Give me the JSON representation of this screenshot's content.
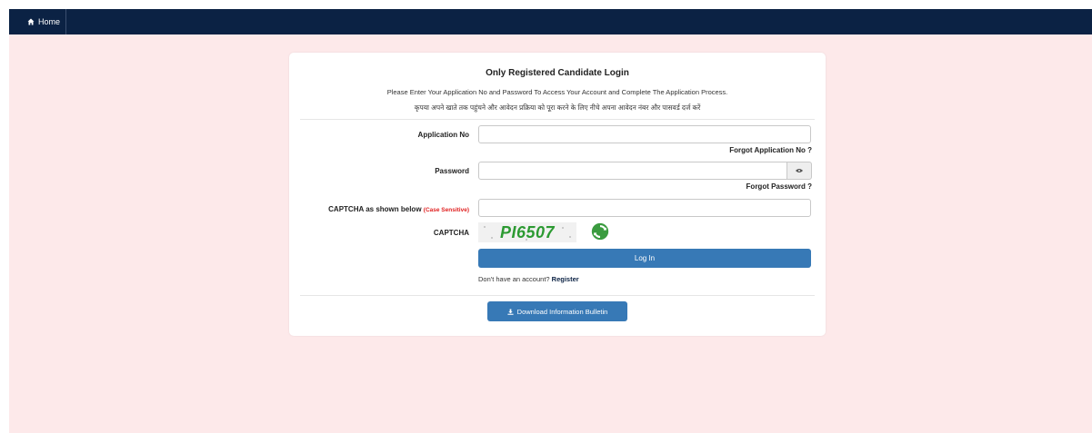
{
  "nav": {
    "home_label": "Home",
    "home_icon": "home-icon"
  },
  "card": {
    "title": "Only Registered Candidate Login",
    "subtitle": "Please Enter Your Application No and Password To Access Your Account and Complete The Application Process.",
    "hindi_text": "कृपया अपने खाते तक पहुंचने और आवेदन प्रक्रिया को पूरा करने के लिए नीचे अपना आवेदन नंबर और पासवर्ड दर्ज करें"
  },
  "form": {
    "application_no_label": "Application No",
    "application_no_value": "",
    "forgot_application_label": "Forgot Application No ?",
    "password_label": "Password",
    "password_value": "",
    "password_toggle_icon": "eye-icon",
    "forgot_password_label": "Forgot Password ?",
    "captcha_input_label": "CAPTCHA as shown below",
    "captcha_case_note": "(Case Sensitive)",
    "captcha_input_value": "",
    "captcha_label": "CAPTCHA",
    "captcha_code": "PI6507",
    "refresh_icon": "refresh-icon",
    "login_label": "Log In",
    "no_account_text": "Don't have an account?",
    "register_label": "Register",
    "download_label": "Download Information Bulletin",
    "download_icon": "download-icon"
  },
  "colors": {
    "navbar": "#0b2244",
    "page_background": "#fde9ea",
    "primary_button": "#3779b6",
    "captcha_text": "#2c9a32",
    "case_sensitive_note": "#e02020"
  }
}
